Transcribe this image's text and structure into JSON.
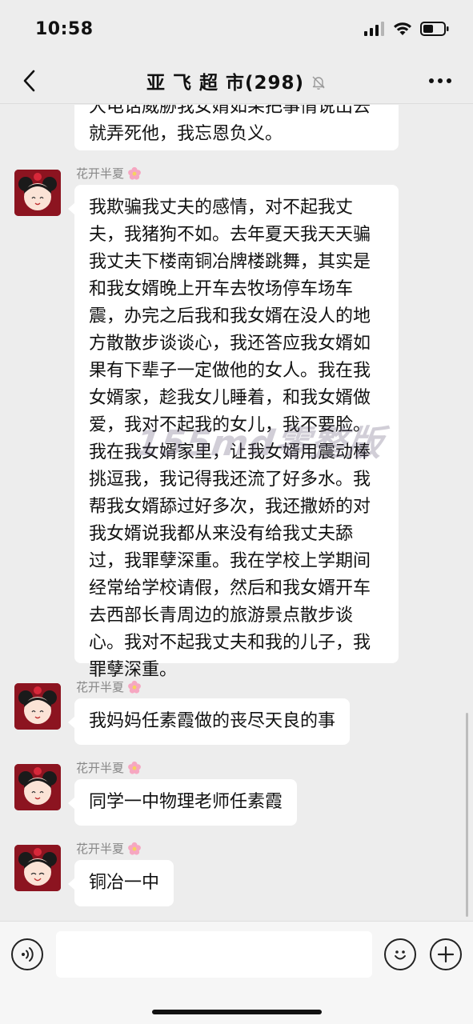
{
  "status": {
    "time": "10:58"
  },
  "header": {
    "title": "亚 飞 超 市(298)"
  },
  "messages": [
    {
      "sender": "",
      "text": "大电话威胁我女婿如果把事情说出去就弄死他，我忘恩负义。"
    },
    {
      "sender": "花开半夏",
      "text": "我欺骗我丈夫的感情，对不起我丈夫，我猪狗不如。去年夏天我天天骗我丈夫下楼南铜冶牌楼跳舞，其实是和我女婿晚上开车去牧场停车场车震，办完之后我和我女婿在没人的地方散散步谈谈心，我还答应我女婿如果有下辈子一定做他的女人。我在我女婿家，趁我女儿睡着，和我女婿做爱，我对不起我的女儿，我不要脸。我在我女婿家里，让我女婿用震动棒挑逗我，我记得我还流了好多水。我帮我女婿舔过好多次，我还撒娇的对我女婿说我都从来没有给我丈夫舔过，我罪孽深重。我在学校上学期间经常给学校请假，然后和我女婿开车去西部长青周边的旅游景点散步谈心。我对不起我丈夫和我的儿子，我罪孽深重。"
    },
    {
      "sender": "花开半夏",
      "text": "我妈妈任素霞做的丧尽天良的事"
    },
    {
      "sender": "花开半夏",
      "text": "同学一中物理老师任素霞"
    },
    {
      "sender": "花开半夏",
      "text": "铜冶一中"
    }
  ],
  "watermark": "155md零整版",
  "input": {
    "value": ""
  },
  "icons": {
    "back": "chevron-left-icon",
    "more": "more-dots-icon",
    "mute": "bell-mute-icon",
    "voice": "voice-icon",
    "emoji": "emoji-icon",
    "plus": "plus-icon",
    "flower": "flower-emoji"
  },
  "colors": {
    "background": "#ededed",
    "bubble": "#ffffff",
    "sender": "#888888"
  }
}
